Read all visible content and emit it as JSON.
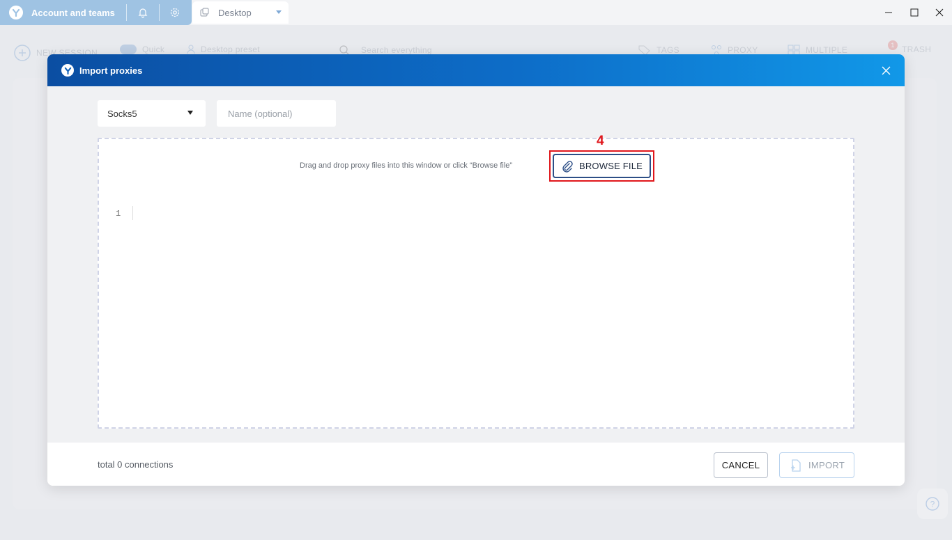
{
  "titlebar": {
    "account_label": "Account and teams",
    "desktop_tab_label": "Desktop",
    "icons": [
      "app-logo-icon",
      "bell-icon",
      "gear-icon",
      "desktop-icon",
      "chevron-down-icon"
    ]
  },
  "toolbar": {
    "new_session": "NEW SESSION",
    "quick": "Quick",
    "preset": "Desktop preset",
    "search_placeholder": "Search everything",
    "tags": "TAGS",
    "proxy": "PROXY",
    "multiple": "MULTIPLE",
    "trash": "TRASH",
    "trash_badge": "1"
  },
  "modal": {
    "title": "Import proxies",
    "proxy_type": "Socks5",
    "name_placeholder": "Name (optional)",
    "drop_hint": "Drag and drop proxy files into this window or click “Browse file”",
    "step_marker": "4",
    "browse_label": "BROWSE FILE",
    "editor_line": "1",
    "total_text": "total 0 connections",
    "cancel_label": "CANCEL",
    "import_label": "IMPORT"
  },
  "colors": {
    "header_start": "#0b4ea2",
    "header_end": "#1198e8",
    "highlight": "#e0161b",
    "browse_border": "#2c4e86"
  }
}
